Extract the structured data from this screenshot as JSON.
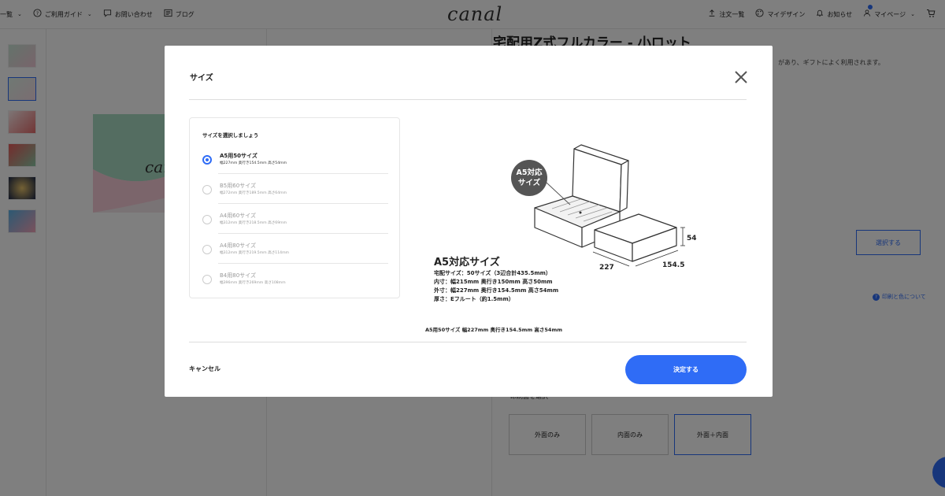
{
  "header": {
    "nav_left": [
      {
        "label": "一覧",
        "icon": "none"
      },
      {
        "label": "ご利用ガイド",
        "icon": "question-circle-icon"
      },
      {
        "label": "お問い合わせ",
        "icon": "chat-icon"
      },
      {
        "label": "ブログ",
        "icon": "news-icon"
      }
    ],
    "logo": "canal",
    "nav_right": [
      {
        "label": "注文一覧",
        "icon": "upload-icon"
      },
      {
        "label": "マイデザイン",
        "icon": "palette-icon"
      },
      {
        "label": "お知らせ",
        "icon": "bell-icon"
      },
      {
        "label": "マイページ",
        "icon": "user-icon"
      }
    ]
  },
  "page": {
    "product_title": "宅配用Z式フルカラー - 小ロット",
    "product_desc": "があり、ギフトによく利用されます。",
    "side_select_label": "選択する",
    "print_note": "印刷と色について",
    "print_section_label": "印刷面を選択",
    "print_options": [
      "外面のみ",
      "内面のみ",
      "外面＋内面"
    ],
    "print_selected_index": 2
  },
  "modal": {
    "title": "サイズ",
    "panel_heading": "サイズを選択しましょう",
    "options": [
      {
        "name": "A5用50サイズ",
        "dims": "幅227mm 奥行き154.5mm 高さ54mm",
        "selected": true
      },
      {
        "name": "B5用60サイズ",
        "dims": "幅272mm 奥行き189.5mm 高さ64mm",
        "selected": false
      },
      {
        "name": "A4用60サイズ",
        "dims": "幅312mm 奥行き218.5mm 高さ69mm",
        "selected": false
      },
      {
        "name": "A4用80サイズ",
        "dims": "幅312mm 奥行き219.5mm 高さ114mm",
        "selected": false
      },
      {
        "name": "B4用80サイズ",
        "dims": "幅396mm 奥行き269mm 高さ108mm",
        "selected": false
      }
    ],
    "illustration": {
      "badge_line1": "A5対応",
      "badge_line2": "サイズ",
      "title": "A5対応サイズ",
      "lines": [
        "宅配サイズ：50サイズ（3辺合計435.5mm）",
        "内寸：幅215mm 奥行き150mm 高さ50mm",
        "外寸：幅227mm 奥行き154.5mm 高さ54mm",
        "厚さ：Eフルート（約1.5mm）"
      ],
      "dim_height": "54",
      "dim_width": "227",
      "dim_depth": "154.5"
    },
    "caption": "A5用50サイズ 幅227mm 奥行き154.5mm 高さ54mm",
    "cancel_label": "キャンセル",
    "confirm_label": "決定する"
  },
  "colors": {
    "accent": "#2f6cf6",
    "overlay": "rgba(0,0,0,0.5)"
  }
}
